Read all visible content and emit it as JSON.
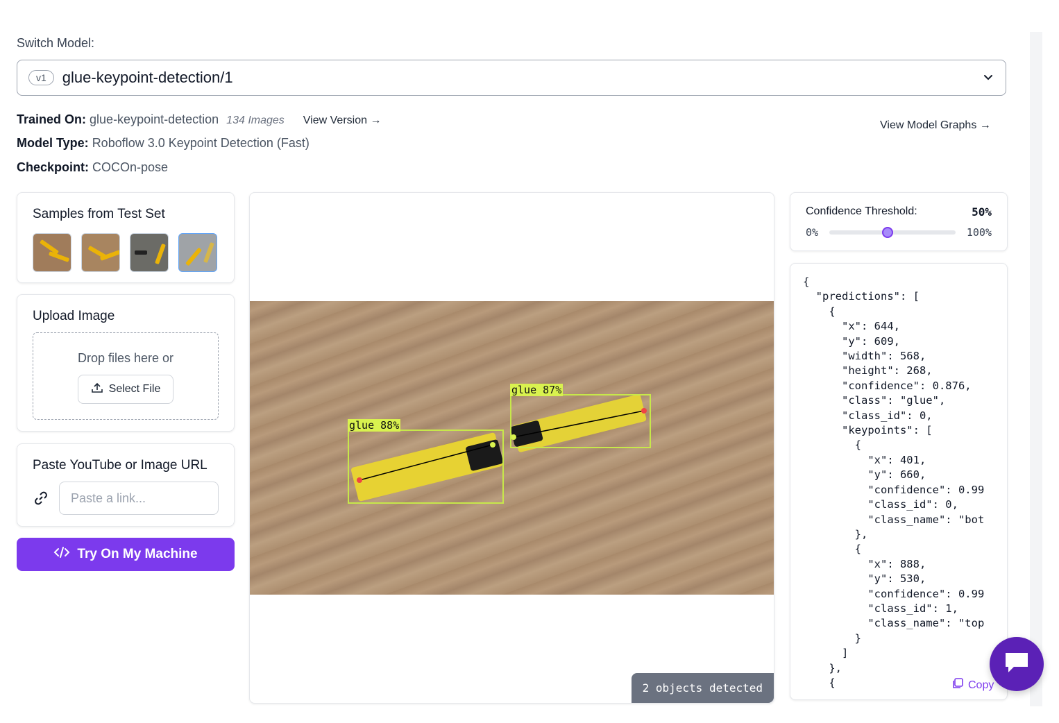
{
  "header": {
    "switch_label": "Switch Model:",
    "model_version_badge": "v1",
    "model_name": "glue-keypoint-detection/1"
  },
  "info": {
    "trained_on_label": "Trained On:",
    "trained_on_value": "glue-keypoint-detection",
    "image_count": "134 Images",
    "view_version_label": "View Version →",
    "model_type_label": "Model Type:",
    "model_type_value": "Roboflow 3.0 Keypoint Detection (Fast)",
    "checkpoint_label": "Checkpoint:",
    "checkpoint_value": "COCOn-pose",
    "view_graphs_label": "View Model Graphs →"
  },
  "samples": {
    "title": "Samples from Test Set"
  },
  "upload": {
    "title": "Upload Image",
    "drop_text": "Drop files here or",
    "select_file_label": "Select File"
  },
  "url": {
    "title": "Paste YouTube or Image URL",
    "placeholder": "Paste a link..."
  },
  "try_button": {
    "label": "Try On My Machine"
  },
  "detections": [
    {
      "label": "glue 88%"
    },
    {
      "label": "glue 87%"
    }
  ],
  "objects_detected": "2 objects detected",
  "confidence": {
    "label": "Confidence Threshold:",
    "value_text": "50%",
    "value": 0.5,
    "min": "0%",
    "max": "100%"
  },
  "json_output": "{\n  \"predictions\": [\n    {\n      \"x\": 644,\n      \"y\": 609,\n      \"width\": 568,\n      \"height\": 268,\n      \"confidence\": 0.876,\n      \"class\": \"glue\",\n      \"class_id\": 0,\n      \"keypoints\": [\n        {\n          \"x\": 401,\n          \"y\": 660,\n          \"confidence\": 0.99\n          \"class_id\": 0,\n          \"class_name\": \"bot\n        },\n        {\n          \"x\": 888,\n          \"y\": 530,\n          \"confidence\": 0.99\n          \"class_id\": 1,\n          \"class_name\": \"top\n        }\n      ]\n    },\n    {",
  "copy_label": "Copy",
  "colors": {
    "accent": "#7c3aed",
    "bbox": "#c7e84a",
    "pill": "#6b7280"
  }
}
